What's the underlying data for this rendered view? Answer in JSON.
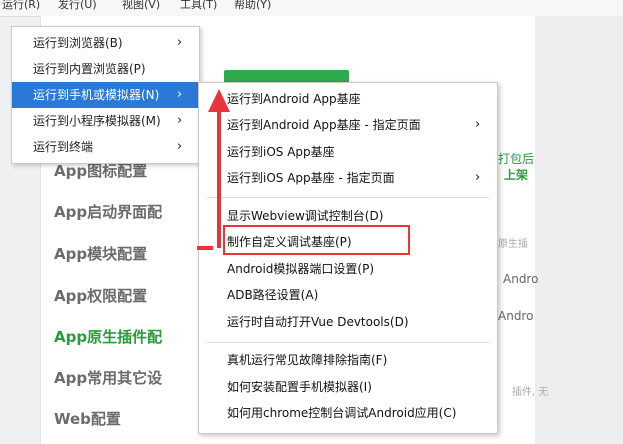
{
  "menubar": {
    "items": [
      "运行(R)",
      "发行(U)",
      "视图(V)",
      "工具(T)",
      "帮助(Y)"
    ]
  },
  "settings": {
    "sidebar": [
      {
        "label": "App图标配置",
        "active": false
      },
      {
        "label": "App启动界面配",
        "active": false
      },
      {
        "label": "App模块配置",
        "active": false
      },
      {
        "label": "App权限配置",
        "active": false
      },
      {
        "label": "App原生插件配",
        "active": true
      },
      {
        "label": "App常用其它设",
        "active": false
      },
      {
        "label": "Web配置",
        "active": false
      }
    ],
    "fragments": {
      "right1": "打包后",
      "right2": "上架",
      "right3": "原生插",
      "right4": "Andro",
      "right5": "Andro",
      "right6": "插件, 无"
    }
  },
  "menu_run": {
    "items": [
      {
        "label": "运行到浏览器(B)",
        "submenu": true,
        "highlighted": false
      },
      {
        "label": "运行到内置浏览器(P)",
        "submenu": false,
        "highlighted": false
      },
      {
        "label": "运行到手机或模拟器(N)",
        "submenu": true,
        "highlighted": true
      },
      {
        "label": "运行到小程序模拟器(M)",
        "submenu": true,
        "highlighted": false
      },
      {
        "label": "运行到终端",
        "submenu": true,
        "highlighted": false
      }
    ]
  },
  "menu_device": {
    "items": [
      {
        "label": "运行到Android App基座",
        "submenu": false
      },
      {
        "label": "运行到Android App基座 - 指定页面",
        "submenu": true
      },
      {
        "label": "运行到iOS App基座",
        "submenu": false
      },
      {
        "label": "运行到iOS App基座 - 指定页面",
        "submenu": true
      },
      {
        "label": "显示Webview调试控制台(D)",
        "submenu": false
      },
      {
        "label": "制作自定义调试基座(P)",
        "submenu": false
      },
      {
        "label": "Android模拟器端口设置(P)",
        "submenu": false
      },
      {
        "label": "ADB路径设置(A)",
        "submenu": false
      },
      {
        "label": "运行时自动打开Vue Devtools(D)",
        "submenu": false
      },
      {
        "label": "真机运行常见故障排除指南(F)",
        "submenu": false
      },
      {
        "label": "如何安装配置手机模拟器(I)",
        "submenu": false
      },
      {
        "label": "如何用chrome控制台调试Android应用(C)",
        "submenu": false
      }
    ]
  },
  "icons": {
    "submenu_arrow": "chevron-right-icon",
    "annotation_arrow": "red-arrow-icon"
  },
  "colors": {
    "highlight": "#2b79d6",
    "annotation": "#e8343a",
    "active_green": "#2a9c3a",
    "button_green": "#2eaa4a"
  }
}
